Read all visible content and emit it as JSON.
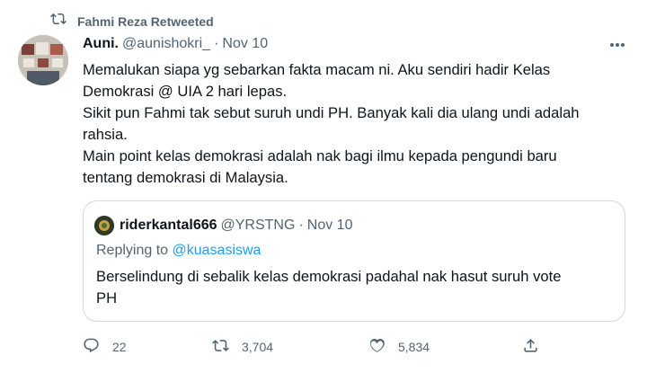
{
  "retweet": {
    "text": "Fahmi Reza Retweeted"
  },
  "tweet": {
    "name": "Auni.",
    "handle": "@aunishokri_",
    "separator": "·",
    "date": "Nov 10",
    "lines": [
      "Memalukan siapa yg sebarkan fakta macam ni. Aku sendiri hadir Kelas",
      "Demokrasi @ UIA 2 hari lepas.",
      "Sikit pun Fahmi tak sebut suruh undi PH. Banyak kali dia ulang undi adalah",
      "rahsia.",
      "Main point kelas demokrasi adalah nak bagi ilmu kepada pengundi baru",
      "tentang demokrasi di Malaysia."
    ]
  },
  "quote": {
    "name": "riderkantal666",
    "handle": "@YRSTNG",
    "separator": "·",
    "date": "Nov 10",
    "replying_prefix": "Replying to ",
    "replying_handle": "@kuasasiswa",
    "lines": [
      "Berselindung di sebalik kelas demokrasi padahal nak hasut suruh vote",
      "PH"
    ]
  },
  "actions": {
    "replies": "22",
    "retweets": "3,704",
    "likes": "5,834"
  },
  "icons": {
    "retweet": "retweet-icon",
    "more": "more-icon",
    "reply": "reply-icon",
    "like": "heart-icon",
    "share": "share-icon"
  },
  "colors": {
    "muted": "#536471",
    "link": "#1d9bf0",
    "border": "#cfd9de",
    "text": "#0f1419"
  }
}
